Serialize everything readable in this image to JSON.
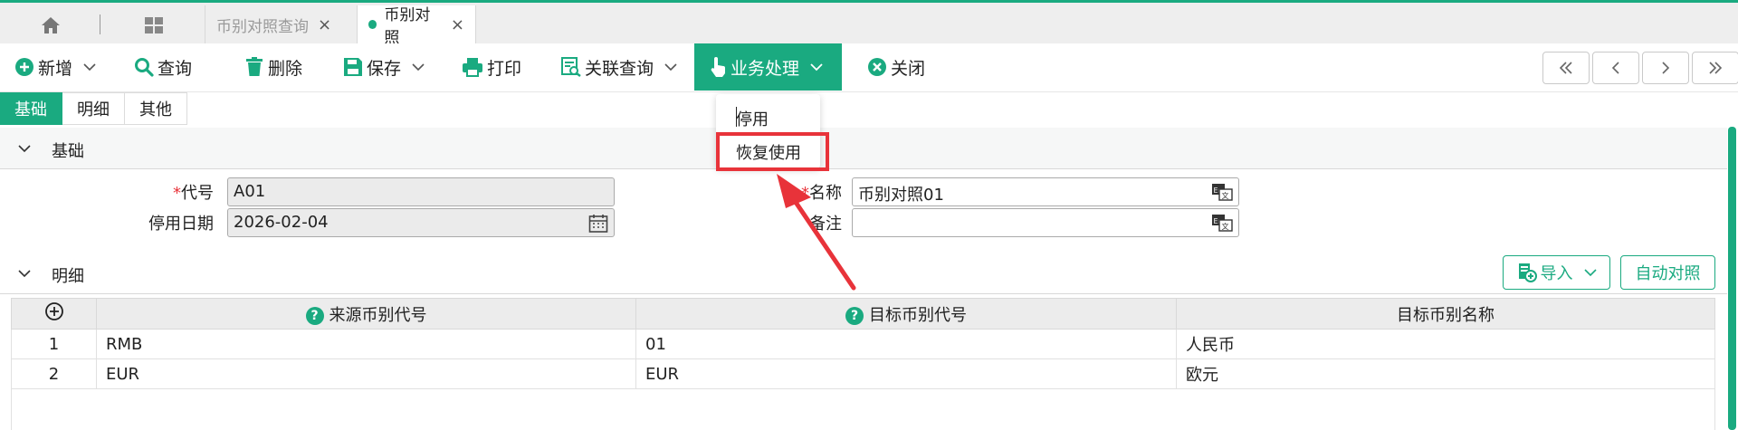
{
  "tabs": [
    {
      "label": "币别对照查询",
      "close": "×"
    },
    {
      "label": "币别对照",
      "close": "×"
    }
  ],
  "toolbar": {
    "add": "新增",
    "query": "查询",
    "delete": "删除",
    "save": "保存",
    "print": "打印",
    "related_query": "关联查询",
    "business": "业务处理",
    "close": "关闭"
  },
  "dropdown": {
    "items": [
      "停用",
      "恢复使用"
    ]
  },
  "form_tabs": [
    "基础",
    "明细",
    "其他"
  ],
  "sections": {
    "basic": "基础",
    "detail": "明细"
  },
  "form": {
    "required_mark": "*",
    "code_label": "代号",
    "code_value": "A01",
    "name_label": "名称",
    "name_value": "币别对照01",
    "disable_date_label": "停用日期",
    "disable_date_value": "2026-02-04",
    "remark_label": "备注",
    "remark_value": ""
  },
  "detail_buttons": {
    "import": "导入",
    "auto_map": "自动对照"
  },
  "table": {
    "add_symbol": "⊕",
    "help_symbol": "?",
    "columns": [
      "来源币别代号",
      "目标币别代号",
      "目标币别名称"
    ],
    "rows": [
      {
        "index": "1",
        "source": "RMB",
        "target": "01",
        "name": "人民币"
      },
      {
        "index": "2",
        "source": "EUR",
        "target": "EUR",
        "name": "欧元"
      }
    ]
  },
  "icons": {
    "home": "home-icon",
    "apps": "grid-icon",
    "add": "plus-circle-icon",
    "query": "search-icon",
    "delete": "trash-icon",
    "save": "floppy-icon",
    "print": "printer-icon",
    "related": "document-search-icon",
    "business": "hand-pointer-icon",
    "close": "close-circle-icon",
    "translate": "translate-icon",
    "calendar": "calendar-icon"
  },
  "colors": {
    "accent": "#1aaa80",
    "highlight": "#e8333a"
  }
}
